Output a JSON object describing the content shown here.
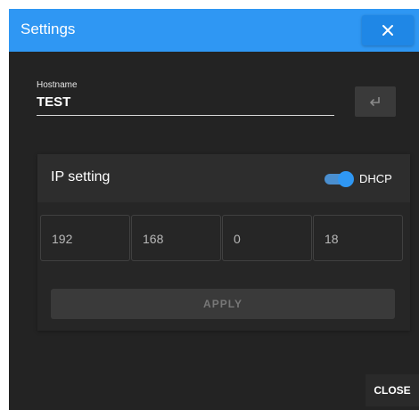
{
  "dialog": {
    "title": "Settings",
    "close_icon": "close-icon"
  },
  "hostname": {
    "label": "Hostname",
    "value": "TEST",
    "enter_icon": "enter-return-icon"
  },
  "ip_setting": {
    "title": "IP setting",
    "dhcp_label": "DHCP",
    "dhcp_enabled": true,
    "octets": [
      "192",
      "168",
      "0",
      "18"
    ],
    "apply_label": "APPLY"
  },
  "footer": {
    "close_label": "CLOSE"
  },
  "colors": {
    "accent": "#2f97f3",
    "background": "#232323"
  }
}
